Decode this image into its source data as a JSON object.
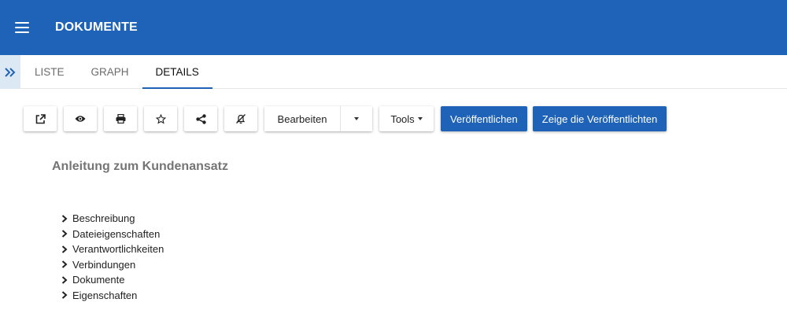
{
  "header": {
    "title": "DOKUMENTE",
    "menu_icon": "hamburger-icon",
    "color": "#1e63b8"
  },
  "tabs": {
    "expand_icon": "double-chevron-right-icon",
    "items": [
      {
        "label": "LISTE",
        "active": false
      },
      {
        "label": "GRAPH",
        "active": false
      },
      {
        "label": "DETAILS",
        "active": true
      }
    ]
  },
  "toolbar": {
    "icon_buttons": [
      "external-link-icon",
      "eye-icon",
      "print-icon",
      "star-icon",
      "share-icon",
      "bell-off-icon"
    ],
    "edit_label": "Bearbeiten",
    "tools_label": "Tools",
    "publish_label": "Veröffentlichen",
    "show_published_label": "Zeige die Veröffentlichten"
  },
  "document": {
    "title": "Anleitung zum Kundenansatz",
    "sections": [
      "Beschreibung",
      "Dateieigenschaften",
      "Verantwortlichkeiten",
      "Verbindungen",
      "Dokumente",
      "Eigenschaften"
    ]
  }
}
